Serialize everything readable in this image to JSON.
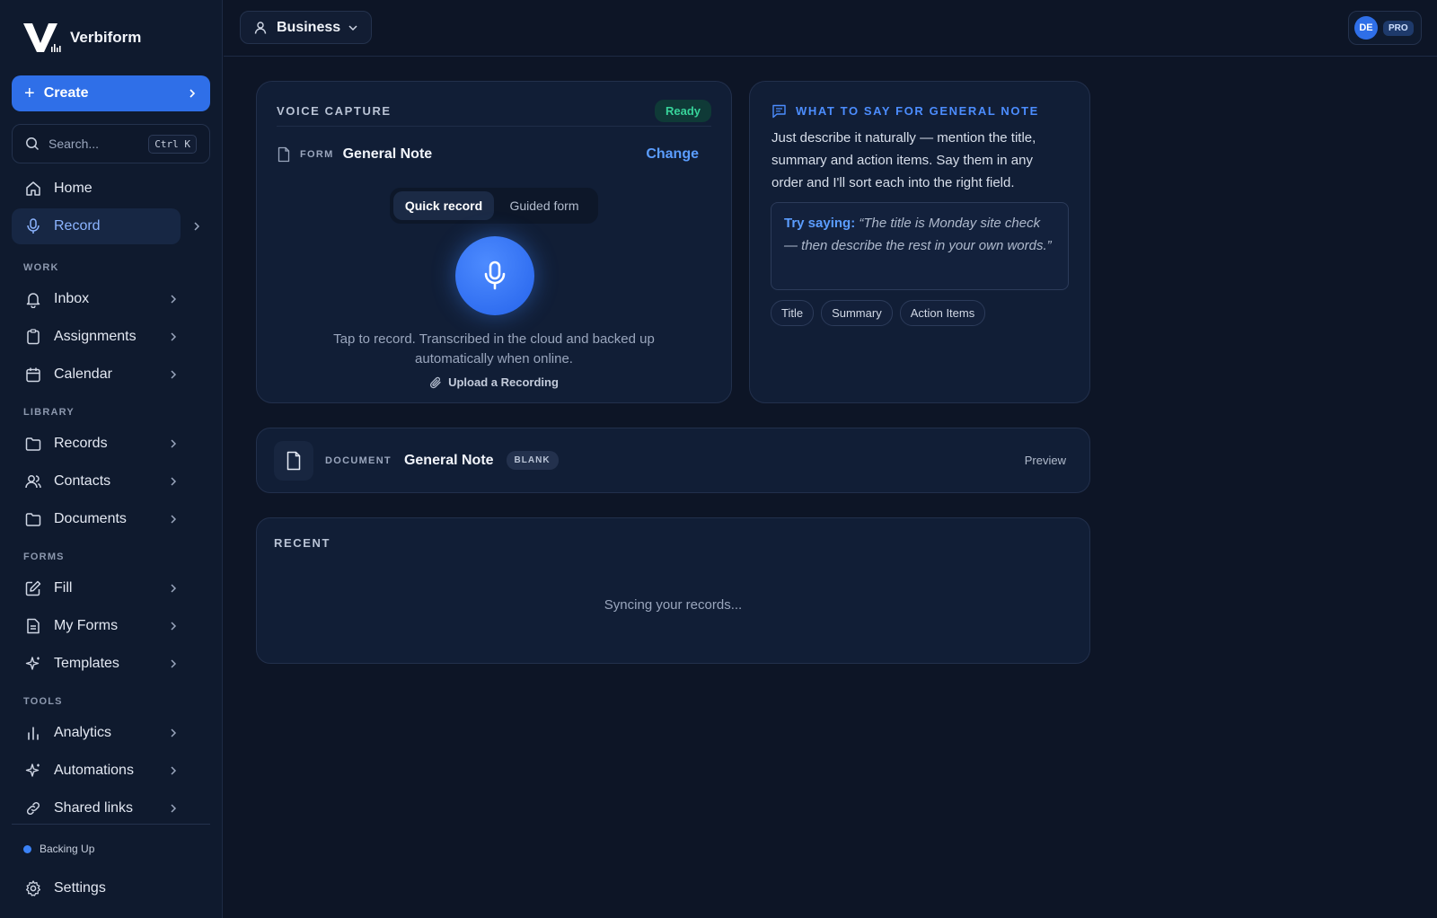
{
  "brand": {
    "name": "Verbiform"
  },
  "sidebar": {
    "create_label": "Create",
    "search_placeholder": "Search...",
    "search_shortcut": "Ctrl K",
    "home": "Home",
    "record": "Record",
    "sections": {
      "work": "WORK",
      "library": "LIBRARY",
      "forms": "FORMS",
      "tools": "TOOLS"
    },
    "work_items": [
      "Inbox",
      "Assignments",
      "Calendar"
    ],
    "library_items": [
      "Records",
      "Contacts",
      "Documents"
    ],
    "forms_items": [
      "Fill",
      "My Forms",
      "Templates"
    ],
    "tools_items": [
      "Analytics",
      "Automations",
      "Shared links"
    ],
    "status": "Backing Up",
    "settings": "Settings"
  },
  "topbar": {
    "workspace": "Business",
    "user_initials": "DE",
    "plan_badge": "PRO"
  },
  "voice_capture": {
    "title": "VOICE CAPTURE",
    "status": "Ready",
    "form_tag": "FORM",
    "form_name": "General Note",
    "change_label": "Change",
    "modes": [
      "Quick record",
      "Guided form"
    ],
    "active_mode": "Quick record",
    "hint": "Tap to record. Transcribed in the cloud and backed up automatically when online.",
    "upload_label": "Upload a Recording"
  },
  "guide": {
    "title": "WHAT TO SAY FOR GENERAL NOTE",
    "body": "Just describe it naturally — mention the title, summary and action items. Say them in any order and I'll sort each into the right field.",
    "try_label": "Try saying:",
    "example": "“The title is Monday site check — then describe the rest in your own words.”",
    "fields": [
      "Title",
      "Summary",
      "Action Items"
    ]
  },
  "document": {
    "tag": "DOCUMENT",
    "name": "General Note",
    "badge": "BLANK",
    "preview_label": "Preview"
  },
  "recent": {
    "title": "RECENT",
    "empty_text": "Syncing your records..."
  },
  "colors": {
    "accent": "#2f6fe8",
    "background": "#0d1526",
    "ready": "#37d39a",
    "link": "#5b9dff"
  }
}
